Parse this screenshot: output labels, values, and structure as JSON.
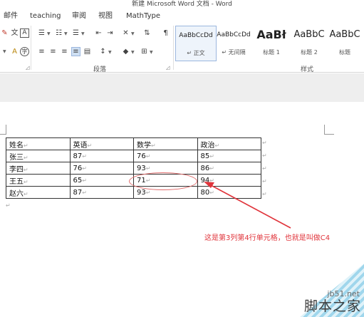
{
  "window": {
    "title": "新建 Microsoft Word 文档 - Word"
  },
  "menu": [
    "邮件",
    "teaching",
    "审阅",
    "视图",
    "MathType"
  ],
  "ribbon": {
    "groups": [
      {
        "label": "段落"
      },
      {
        "label": "样式"
      }
    ],
    "styles": [
      {
        "sample": "AaBbCcDd",
        "name": "↵ 正文"
      },
      {
        "sample": "AaBbCcDd",
        "name": "↵ 无间隔"
      },
      {
        "sample": "AaBł",
        "name": "标题 1"
      },
      {
        "sample": "AaBbC",
        "name": "标题 2"
      },
      {
        "sample": "AaBbC",
        "name": "标题"
      }
    ],
    "icons": [
      "bullet-list-icon",
      "numbered-list-icon",
      "multilevel-list-icon",
      "decrease-indent-icon",
      "increase-indent-icon",
      "chinese-layout-icon",
      "sort-icon",
      "show-marks-icon",
      "align-left-icon",
      "align-center-icon",
      "align-right-icon",
      "justify-icon",
      "distributed-icon",
      "line-spacing-icon",
      "shading-icon",
      "borders-icon",
      "phonetic-icon",
      "enclose-char-icon",
      "clear-format-icon",
      "char-border-icon"
    ]
  },
  "table": {
    "rows": [
      [
        "姓名",
        "英语",
        "数学",
        "政治"
      ],
      [
        "张三",
        "87",
        "76",
        "85"
      ],
      [
        "李四",
        "76",
        "93",
        "86"
      ],
      [
        "王五",
        "65",
        "71",
        "94"
      ],
      [
        "赵六",
        "87",
        "93",
        "80"
      ]
    ],
    "cell_mark": "↵"
  },
  "annotation": {
    "text": "这是第3列第4行单元格，也就是叫做C4",
    "color": "#e0343b"
  },
  "watermark": {
    "url": "jb51.net",
    "name": "脚本之家"
  }
}
